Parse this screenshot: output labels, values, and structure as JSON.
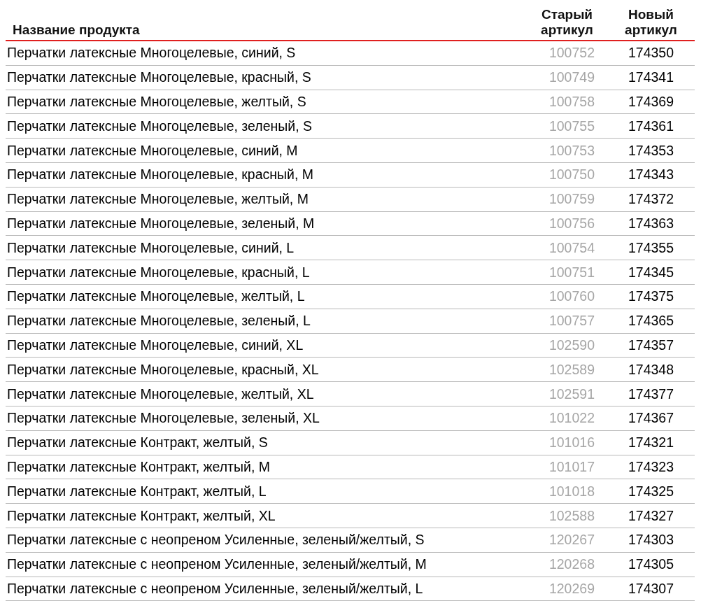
{
  "table": {
    "columns": [
      "Название продукта",
      "Старый артикул",
      "Новый артикул"
    ],
    "rows": [
      [
        "Перчатки латексные Многоцелевые, синий, S",
        "100752",
        "174350"
      ],
      [
        "Перчатки латексные Многоцелевые, красный, S",
        "100749",
        "174341"
      ],
      [
        "Перчатки латексные Многоцелевые, желтый, S",
        "100758",
        "174369"
      ],
      [
        "Перчатки латексные Многоцелевые, зеленый, S",
        "100755",
        "174361"
      ],
      [
        "Перчатки латексные Многоцелевые, синий, M",
        "100753",
        "174353"
      ],
      [
        "Перчатки латексные Многоцелевые, красный, M",
        "100750",
        "174343"
      ],
      [
        "Перчатки латексные Многоцелевые, желтый, M",
        "100759",
        "174372"
      ],
      [
        "Перчатки латексные Многоцелевые, зеленый, M",
        "100756",
        "174363"
      ],
      [
        "Перчатки латексные Многоцелевые, синий, L",
        "100754",
        "174355"
      ],
      [
        "Перчатки латексные Многоцелевые, красный, L",
        "100751",
        "174345"
      ],
      [
        "Перчатки латексные Многоцелевые, желтый, L",
        "100760",
        "174375"
      ],
      [
        "Перчатки латексные Многоцелевые, зеленый, L",
        "100757",
        "174365"
      ],
      [
        "Перчатки латексные Многоцелевые, синий, XL",
        "102590",
        "174357"
      ],
      [
        "Перчатки латексные Многоцелевые, красный, XL",
        "102589",
        "174348"
      ],
      [
        "Перчатки латексные Многоцелевые, желтый, XL",
        "102591",
        "174377"
      ],
      [
        "Перчатки латексные Многоцелевые, зеленый, XL",
        "101022",
        "174367"
      ],
      [
        "Перчатки латексные Контракт, желтый, S",
        "101016",
        "174321"
      ],
      [
        "Перчатки латексные Контракт, желтый, M",
        "101017",
        "174323"
      ],
      [
        "Перчатки латексные Контракт, желтый, L",
        "101018",
        "174325"
      ],
      [
        "Перчатки латексные Контракт, желтый, XL",
        "102588",
        "174327"
      ],
      [
        "Перчатки латексные с неопреном Усиленные, зеленый/желтый, S",
        "120267",
        "174303"
      ],
      [
        "Перчатки латексные с неопреном Усиленные, зеленый/желтый, M",
        "120268",
        "174305"
      ],
      [
        "Перчатки латексные с неопреном Усиленные, зеленый/желтый, L",
        "120269",
        "174307"
      ]
    ]
  }
}
